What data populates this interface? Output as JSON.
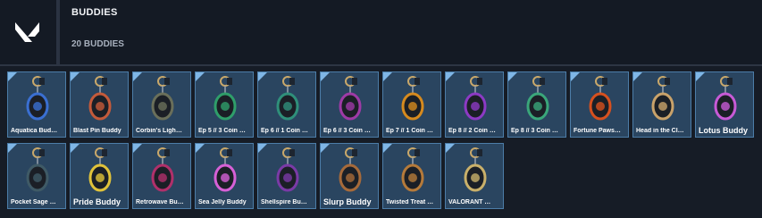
{
  "header": {
    "title": "BUDDIES",
    "count": "20 BUDDIES"
  },
  "colors": {
    "tile_bg": "#2a4560",
    "tile_border": "#4c7da8",
    "accent": "#7fb6e6",
    "background": "#141a23"
  },
  "buddies": [
    {
      "label": "Aquatica Bud…",
      "icon": "aquatica-charm-icon",
      "color": "#3a6fd1",
      "big": false
    },
    {
      "label": "Blast Pin Buddy",
      "icon": "blast-pin-charm-icon",
      "color": "#c45a3a",
      "big": false
    },
    {
      "label": "Corbin's Ligh…",
      "icon": "corbin-light-charm-icon",
      "color": "#6a6f5a",
      "big": false
    },
    {
      "label": "Ep 5 // 3 Coin …",
      "icon": "ep5-coin-charm-icon",
      "color": "#2f9e6a",
      "big": false
    },
    {
      "label": "Ep 6 // 1 Coin …",
      "icon": "ep6-1-coin-charm-icon",
      "color": "#2f8f7a",
      "big": false
    },
    {
      "label": "Ep 6 // 3 Coin …",
      "icon": "ep6-3-coin-charm-icon",
      "color": "#9e3aa6",
      "big": false
    },
    {
      "label": "Ep 7 // 1 Coin …",
      "icon": "ep7-coin-charm-icon",
      "color": "#d68a1e",
      "big": false
    },
    {
      "label": "Ep 8 // 2 Coin …",
      "icon": "ep8-2-coin-charm-icon",
      "color": "#8c3ac4",
      "big": false
    },
    {
      "label": "Ep 8 // 3 Coin …",
      "icon": "ep8-3-coin-charm-icon",
      "color": "#3aa67a",
      "big": false
    },
    {
      "label": "Fortune Paws…",
      "icon": "fortune-paws-charm-icon",
      "color": "#d6501e",
      "big": false
    },
    {
      "label": "Head in the Cl…",
      "icon": "head-in-clouds-charm-icon",
      "color": "#c9a26a",
      "big": false
    },
    {
      "label": "Lotus Buddy",
      "icon": "lotus-charm-icon",
      "color": "#c75ad6",
      "big": true
    },
    {
      "label": "Pocket Sage …",
      "icon": "pocket-sage-charm-icon",
      "color": "#3f5a66",
      "big": false
    },
    {
      "label": "Pride Buddy",
      "icon": "pride-charm-icon",
      "color": "#e0c23a",
      "big": true
    },
    {
      "label": "Retrowave Bu…",
      "icon": "retrowave-charm-icon",
      "color": "#b0306a",
      "big": false
    },
    {
      "label": "Sea Jelly Buddy",
      "icon": "sea-jelly-charm-icon",
      "color": "#d660d6",
      "big": false
    },
    {
      "label": "Shellspire Bu…",
      "icon": "shellspire-charm-icon",
      "color": "#7a3aa6",
      "big": false
    },
    {
      "label": "Slurp Buddy",
      "icon": "slurp-charm-icon",
      "color": "#a66a3a",
      "big": true
    },
    {
      "label": "Twisted Treat …",
      "icon": "twisted-treat-charm-icon",
      "color": "#b57a3a",
      "big": false
    },
    {
      "label": "VALORANT …",
      "icon": "valorant-charm-icon",
      "color": "#c9b06a",
      "big": false
    }
  ]
}
